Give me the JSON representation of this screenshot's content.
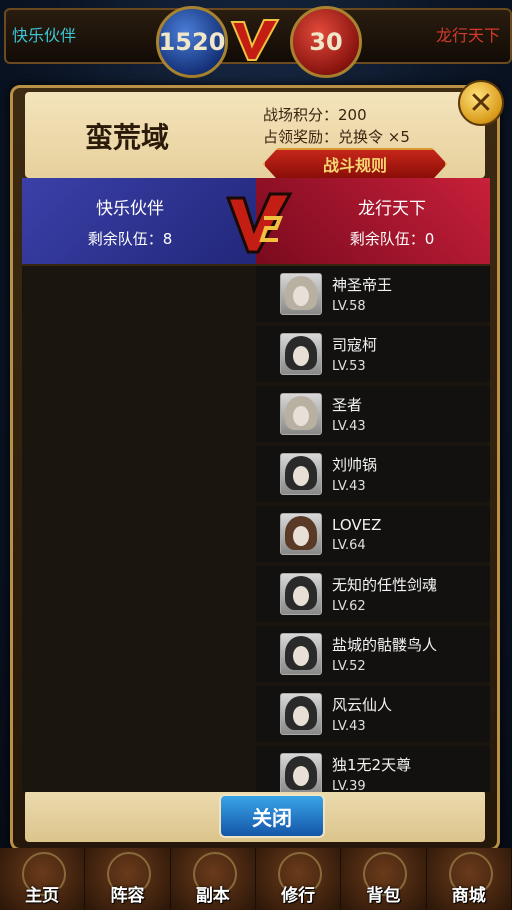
{
  "topbar": {
    "left_team": "快乐伙伴",
    "left_score": "1520",
    "right_score": "30",
    "right_team": "龙行天下"
  },
  "modal": {
    "title": "蛮荒域",
    "battle_points": "战场积分：200",
    "occupy_reward": "占领奖励：兑换令 ×5",
    "rules_button": "战斗规则",
    "close_button": "关闭"
  },
  "versus": {
    "left_team": "快乐伙伴",
    "left_remaining": "剩余队伍：8",
    "right_team": "龙行天下",
    "right_remaining": "剩余队伍：0"
  },
  "roster": [
    {
      "name": "神圣帝王",
      "level": "LV.58",
      "avatar": "light"
    },
    {
      "name": "司寇柯",
      "level": "LV.53",
      "avatar": "dark"
    },
    {
      "name": "圣者",
      "level": "LV.43",
      "avatar": "light"
    },
    {
      "name": "刘帅锅",
      "level": "LV.43",
      "avatar": "dark"
    },
    {
      "name": "LOVEZ",
      "level": "LV.64",
      "avatar": "brown"
    },
    {
      "name": "无知的任性剑魂",
      "level": "LV.62",
      "avatar": "dark"
    },
    {
      "name": "盐城的骷髅鸟人",
      "level": "LV.52",
      "avatar": "dark"
    },
    {
      "name": "风云仙人",
      "level": "LV.43",
      "avatar": "dark"
    },
    {
      "name": "独1无2天尊",
      "level": "LV.39",
      "avatar": "dark"
    }
  ],
  "nav": [
    "主页",
    "阵容",
    "副本",
    "修行",
    "背包",
    "商城"
  ],
  "colors": {
    "blue_team": "#2a30a0",
    "red_team": "#b01830",
    "gold": "#b89046"
  }
}
